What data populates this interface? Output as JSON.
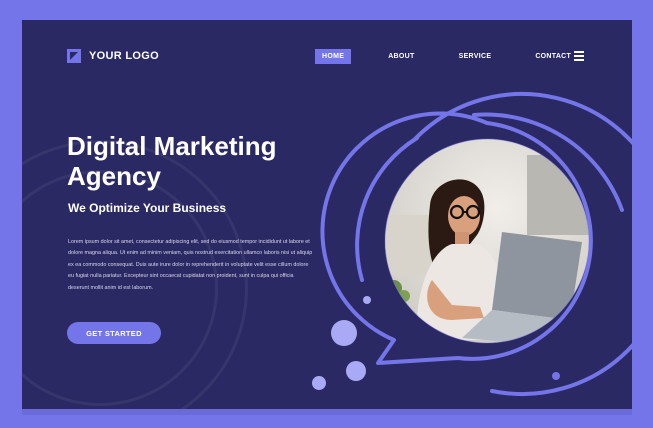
{
  "brand": {
    "logo_text": "YOUR LOGO"
  },
  "nav": {
    "items": [
      {
        "label": "HOME",
        "active": true
      },
      {
        "label": "ABOUT",
        "active": false
      },
      {
        "label": "SERVICE",
        "active": false
      },
      {
        "label": "CONTACT",
        "active": false
      }
    ],
    "menu_icon": "hamburger-menu-icon"
  },
  "hero": {
    "title": "Digital Marketing Agency",
    "subtitle": "We Optimize Your Business",
    "body": "Lorem ipsum dolor sit amet, consectetur adipiscing elit, sed do eiusmod tempor incididunt ut labore et dolore magna aliqua. Ut enim ad minim veniam, quis nostrud exercitation ullamco laboris nisi ut aliquip ex ea commodo consequat. Duis aute irure dolor in reprehenderit in voluptate velit esse cillum dolore eu fugiat nulla pariatur. Excepteur sint occaecat cupidatat non proident, sunt in culpa qui officia deserunt mollit anim id est laborum.",
    "cta_label": "GET STARTED"
  },
  "colors": {
    "background": "#2a2963",
    "accent": "#7475e9",
    "frame": "#7475e9",
    "text": "#ffffff"
  }
}
